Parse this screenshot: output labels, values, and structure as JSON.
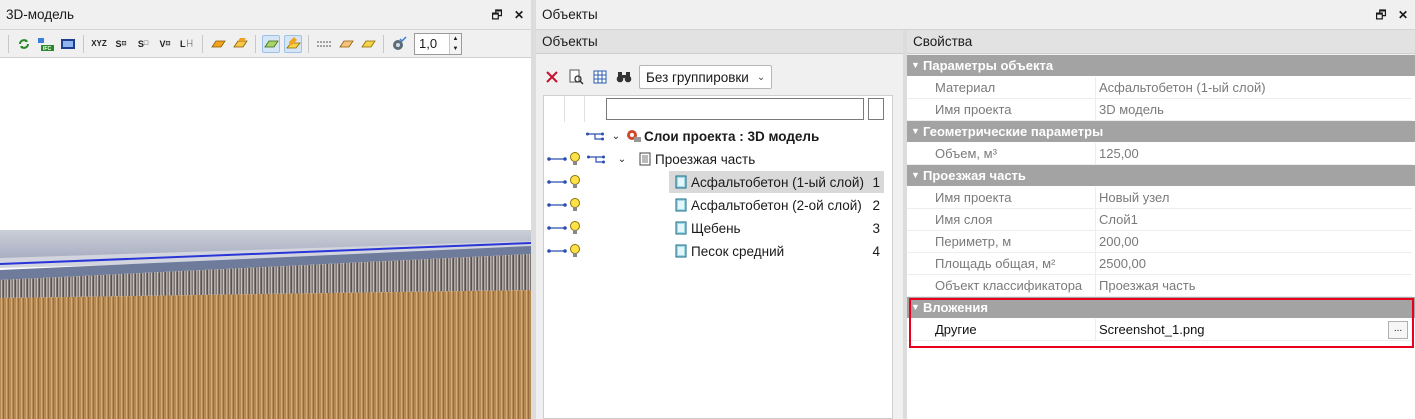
{
  "left_panel": {
    "title": "3D-модель",
    "pin_label": "🗗",
    "close_label": "✕",
    "toolbar": {
      "icons": [
        "refresh-icon",
        "import-ifc-icon",
        "film-icon",
        "xyz-icon",
        "s-node-icon",
        "s-square-icon",
        "v-node-icon",
        "l-measure-icon",
        "orange-solid-icon",
        "orange-solid-2-icon",
        "green-box-icon",
        "yellow-pencil-icon",
        "dotted-grid-icon",
        "orange-box-icon",
        "yellow-box-icon",
        "gear-check-icon"
      ],
      "spin_value": "1,0"
    }
  },
  "right_panel": {
    "title": "Объекты",
    "pin_label": "🗗",
    "close_label": "✕"
  },
  "objects": {
    "header": "Объекты",
    "grouping": "Без группировки",
    "root": "Слои проекта : 3D модель",
    "group": "Проезжая часть",
    "items": [
      {
        "label": "Асфальтобетон (1-ый слой)",
        "num": "1"
      },
      {
        "label": "Асфальтобетон (2-ой слой)",
        "num": "2"
      },
      {
        "label": "Щебень",
        "num": "3"
      },
      {
        "label": "Песок средний",
        "num": "4"
      }
    ]
  },
  "properties": {
    "header": "Свойства",
    "groups": [
      {
        "title": "Параметры объекта",
        "rows": [
          {
            "key": "Материал",
            "value": "Асфальтобетон (1-ый слой)"
          },
          {
            "key": "Имя проекта",
            "value": "3D модель"
          }
        ]
      },
      {
        "title": "Геометрические параметры",
        "rows": [
          {
            "key": "Объем, м³",
            "value": "125,00"
          }
        ]
      },
      {
        "title": "Проезжая часть",
        "rows": [
          {
            "key": "Имя проекта",
            "value": "Новый узел"
          },
          {
            "key": "Имя слоя",
            "value": "Слой1"
          },
          {
            "key": "Периметр, м",
            "value": "200,00"
          },
          {
            "key": "Площадь общая, м²",
            "value": "2500,00"
          },
          {
            "key": "Объект классификатора",
            "value": "Проезжая часть"
          }
        ]
      },
      {
        "title": "Вложения",
        "rows": [
          {
            "key": "Другие",
            "value": "Screenshot_1.png"
          }
        ]
      }
    ],
    "ellipsis": "..."
  },
  "colors": {
    "highlight": "#e8001c",
    "group_bg": "#a3a3a3",
    "selected_row": "#d9d9d9",
    "link_blue": "#2b4fb0"
  }
}
